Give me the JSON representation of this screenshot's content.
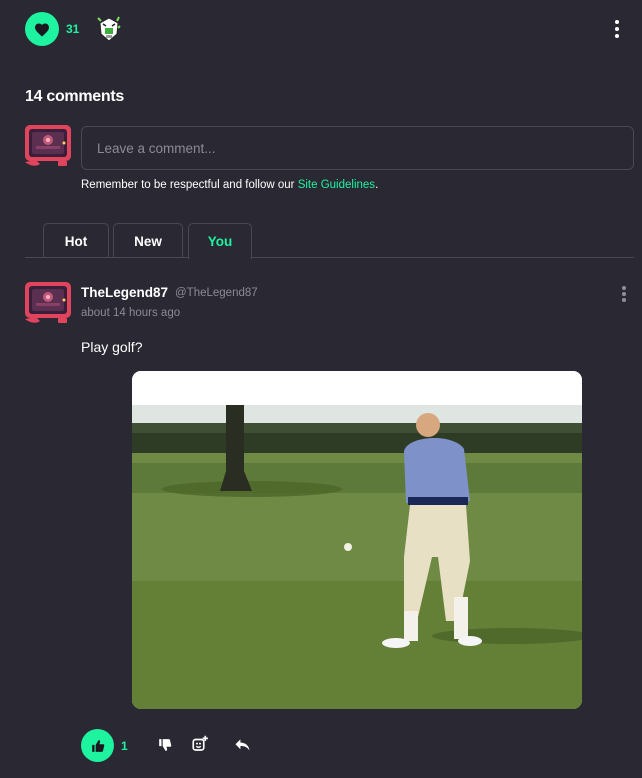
{
  "reactions": {
    "like_count": "31"
  },
  "comments": {
    "title": "14 comments",
    "input_placeholder": "Leave a comment...",
    "guidelines_prefix": "Remember to be respectful and follow our ",
    "guidelines_link": "Site Guidelines",
    "guidelines_suffix": "."
  },
  "tabs": [
    {
      "label": "Hot",
      "active": false
    },
    {
      "label": "New",
      "active": false
    },
    {
      "label": "You",
      "active": true
    }
  ],
  "comment": {
    "username": "TheLegend87",
    "handle": "@TheLegend87",
    "timestamp": "about 14 hours ago",
    "text": "Play golf?",
    "upvote_count": "1"
  },
  "icons": {
    "like": "heart-icon",
    "sticker": "sticker-icon",
    "more": "more-vertical-icon",
    "upvote": "thumbs-up-icon",
    "downvote": "thumbs-down-icon",
    "add_reaction": "add-reaction-icon",
    "reply": "reply-icon"
  },
  "colors": {
    "background": "#2a2833",
    "accent": "#1ef3a0",
    "muted": "#8c8a95",
    "border": "#4a4853"
  }
}
